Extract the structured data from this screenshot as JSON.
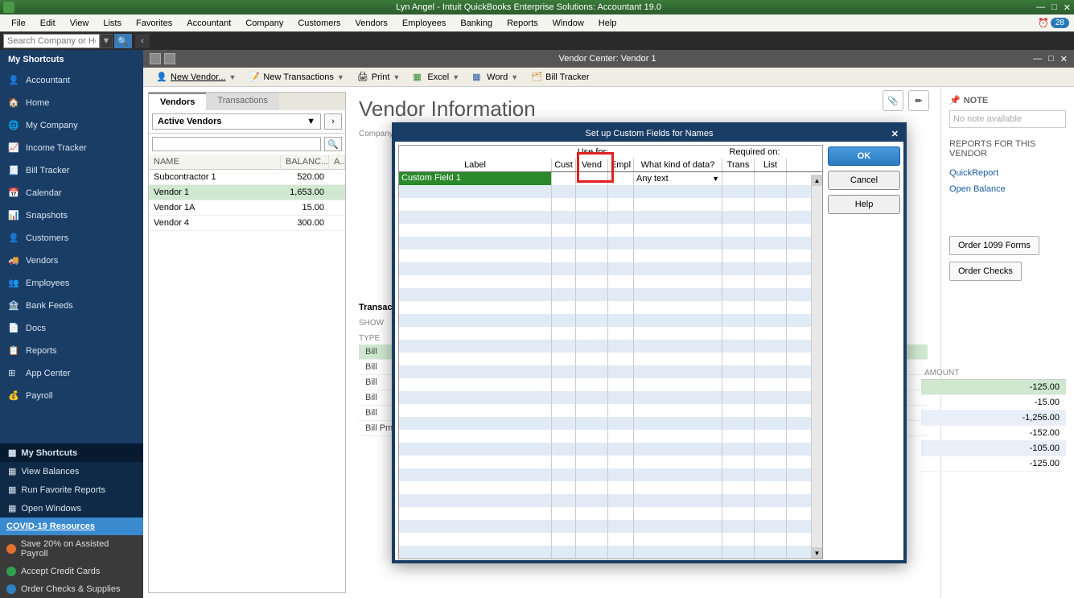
{
  "titlebar": {
    "title": "Lyn Angel  - Intuit QuickBooks Enterprise Solutions: Accountant 19.0"
  },
  "menubar": {
    "items": [
      "File",
      "Edit",
      "View",
      "Lists",
      "Favorites",
      "Accountant",
      "Company",
      "Customers",
      "Vendors",
      "Employees",
      "Banking",
      "Reports",
      "Window",
      "Help"
    ],
    "badge": "28"
  },
  "search": {
    "placeholder": "Search Company or Help"
  },
  "sidebar": {
    "header": "My Shortcuts",
    "items": [
      {
        "label": "Accountant"
      },
      {
        "label": "Home"
      },
      {
        "label": "My Company"
      },
      {
        "label": "Income Tracker"
      },
      {
        "label": "Bill Tracker"
      },
      {
        "label": "Calendar"
      },
      {
        "label": "Snapshots"
      },
      {
        "label": "Customers"
      },
      {
        "label": "Vendors"
      },
      {
        "label": "Employees"
      },
      {
        "label": "Bank Feeds"
      },
      {
        "label": "Docs"
      },
      {
        "label": "Reports"
      },
      {
        "label": "App Center"
      },
      {
        "label": "Payroll"
      }
    ],
    "bottom": [
      {
        "label": "My Shortcuts",
        "active": true
      },
      {
        "label": "View Balances"
      },
      {
        "label": "Run Favorite Reports"
      },
      {
        "label": "Open Windows"
      }
    ],
    "covid": "COVID-19 Resources",
    "promos": [
      {
        "label": "Save 20% on Assisted Payroll",
        "color": "#e07030"
      },
      {
        "label": "Accept Credit Cards",
        "color": "#30a050"
      },
      {
        "label": "Order Checks & Supplies",
        "color": "#3080c0"
      }
    ]
  },
  "subwindow": {
    "title": "Vendor Center: Vendor 1"
  },
  "toolbar": {
    "new_vendor": "New Vendor...",
    "new_trans": "New Transactions",
    "print": "Print",
    "excel": "Excel",
    "word": "Word",
    "bill_tracker": "Bill Tracker"
  },
  "vendor_list": {
    "tabs": {
      "vendors": "Vendors",
      "transactions": "Transactions"
    },
    "filter": "Active Vendors",
    "columns": {
      "name": "NAME",
      "balance": "BALANC...",
      "a": "A..."
    },
    "rows": [
      {
        "name": "Subcontractor 1",
        "balance": "520.00"
      },
      {
        "name": "Vendor 1",
        "balance": "1,653.00",
        "selected": true
      },
      {
        "name": "Vendor 1A",
        "balance": "15.00"
      },
      {
        "name": "Vendor 4",
        "balance": "300.00"
      }
    ]
  },
  "vendor_info": {
    "title": "Vendor Information",
    "company_name_label": "Company Name",
    "trans_label": "Transac",
    "show_label": "SHOW",
    "type_label": "TYPE",
    "trans_rows": [
      "Bill",
      "Bill",
      "Bill",
      "Bill",
      "Bill",
      "Bill Pm"
    ],
    "note_header": "NOTE",
    "note_placeholder": "No note available",
    "reports_header": "REPORTS FOR THIS VENDOR",
    "quickreport": "QuickReport",
    "open_balance": "Open Balance",
    "order_1099": "Order 1099 Forms",
    "order_checks": "Order Checks",
    "amount_header": "AMOUNT",
    "amounts": [
      "-125.00",
      "-15.00",
      "-1,256.00",
      "-152.00",
      "-105.00",
      "-125.00"
    ]
  },
  "modal": {
    "title": "Set up Custom Fields for Names",
    "use_for": "Use for:",
    "required_on": "Required on:",
    "cols": {
      "label": "Label",
      "cust": "Cust",
      "vend": "Vend",
      "empl": "Empl",
      "kind": "What kind of data?",
      "trans": "Trans",
      "list": "List"
    },
    "row1": {
      "label": "Custom Field 1",
      "kind": "Any text"
    },
    "ok": "OK",
    "cancel": "Cancel",
    "help": "Help"
  }
}
